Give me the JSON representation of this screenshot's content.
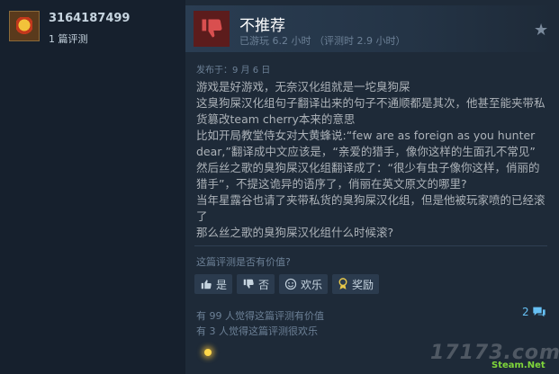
{
  "author": {
    "name": "3164187499",
    "review_count": "1 篇评测"
  },
  "review": {
    "verdict": "不推荐",
    "hours": "已游玩 6.2 小时 （评测时 2.9 小时）",
    "posted": "发布于：9 月 6 日",
    "paragraphs": [
      "游戏是好游戏，无奈汉化组就是一坨臭狗屎",
      "这臭狗屎汉化组句子翻译出来的句子不通顺都是其次，他甚至能夹带私货篡改team cherry本来的意思",
      "比如开局教堂侍女对大黄蜂说:“few are as foreign as you hunter dear,”翻译成中文应该是，“亲爱的猎手，像你这样的生面孔不常见”",
      "然后丝之歌的臭狗屎汉化组翻译成了：“很少有虫子像你这样，俏丽的猎手”，不提这诡异的语序了，俏丽在英文原文的哪里?",
      "当年星露谷也请了夹带私货的臭狗屎汉化组，但是他被玩家喷的已经滚了",
      "那么丝之歌的臭狗屎汉化组什么时候滚?"
    ]
  },
  "feedback": {
    "question": "这篇评测是否有价值?",
    "yes_label": "是",
    "no_label": "否",
    "funny_label": "欢乐",
    "award_label": "奖励",
    "helpful_stat": "有 99 人觉得这篇评测有价值",
    "funny_stat": "有 3 人觉得这篇评测很欢乐",
    "comment_count": "2"
  },
  "icons": {
    "verdict": "thumbs-down-icon",
    "favorite": "star-icon",
    "yes": "thumbs-up-icon",
    "no": "thumbs-down-icon",
    "funny": "smiley-icon",
    "award": "award-icon",
    "comments": "speech-bubble-icon"
  },
  "watermark": {
    "main": "17173.com",
    "sub": "Steam.Net"
  },
  "colors": {
    "verdict_bg": "#5c1c1c",
    "thumb_down": "#d94f4f",
    "link": "#66c0f4"
  }
}
